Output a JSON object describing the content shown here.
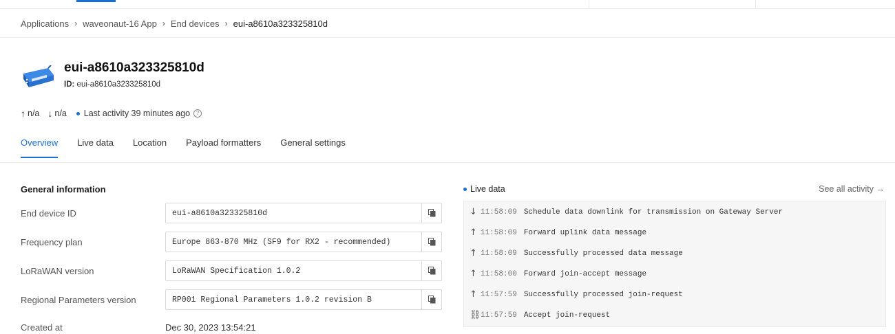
{
  "breadcrumb": [
    {
      "label": "Applications"
    },
    {
      "label": "waveonaut-16 App"
    },
    {
      "label": "End devices"
    },
    {
      "label": "eui-a8610a323325810d"
    }
  ],
  "device": {
    "title": "eui-a8610a323325810d",
    "id_label": "ID:",
    "id_value": "eui-a8610a323325810d"
  },
  "stats": {
    "uplink": "n/a",
    "downlink": "n/a",
    "last_activity": "Last activity 39 minutes ago",
    "help_glyph": "?"
  },
  "tabs": [
    {
      "label": "Overview",
      "active": true
    },
    {
      "label": "Live data",
      "active": false
    },
    {
      "label": "Location",
      "active": false
    },
    {
      "label": "Payload formatters",
      "active": false
    },
    {
      "label": "General settings",
      "active": false
    }
  ],
  "general": {
    "title": "General information",
    "fields": [
      {
        "label": "End device ID",
        "value": "eui-a8610a323325810d"
      },
      {
        "label": "Frequency plan",
        "value": "Europe 863-870 MHz (SF9 for RX2 - recommended)"
      },
      {
        "label": "LoRaWAN version",
        "value": "LoRaWAN Specification 1.0.2"
      },
      {
        "label": "Regional Parameters version",
        "value": "RP001 Regional Parameters 1.0.2 revision B"
      }
    ],
    "created_label": "Created at",
    "created_value": "Dec 30, 2023 13:54:21"
  },
  "live": {
    "title": "Live data",
    "see_all": "See all activity →",
    "events": [
      {
        "icon": "arrow-down-icon",
        "glyph": "↓",
        "time": "11:58:09",
        "message": "Schedule data downlink for transmission on Gateway Server"
      },
      {
        "icon": "arrow-up-icon",
        "glyph": "↑",
        "time": "11:58:09",
        "message": "Forward uplink data message"
      },
      {
        "icon": "arrow-up-icon",
        "glyph": "↑",
        "time": "11:58:09",
        "message": "Successfully processed data message"
      },
      {
        "icon": "arrow-up-icon",
        "glyph": "↑",
        "time": "11:58:00",
        "message": "Forward join-accept message"
      },
      {
        "icon": "arrow-up-icon",
        "glyph": "↑",
        "time": "11:57:59",
        "message": "Successfully processed join-request"
      },
      {
        "icon": "link-icon",
        "glyph": "⛓",
        "time": "11:57:59",
        "message": "Accept join-request"
      }
    ]
  },
  "colors": {
    "accent": "#1a6ed8"
  }
}
